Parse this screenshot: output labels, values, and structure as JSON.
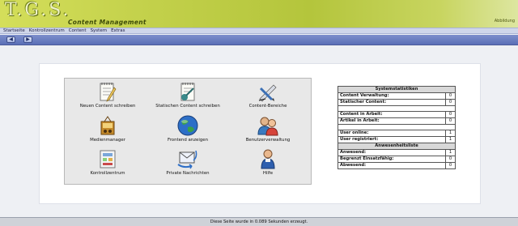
{
  "header": {
    "logo": "T.G.S.",
    "subtitle": "Content Management",
    "corner_text": "Abbildung"
  },
  "menu": [
    "Startseite",
    "Kontrollzentrum",
    "Content",
    "System",
    "Extras"
  ],
  "toolbar": {
    "back_symbol": "◀",
    "forward_symbol": "▶"
  },
  "icons": [
    {
      "label": "Neuen Content schreiben",
      "icon": "notepad-pencil-icon"
    },
    {
      "label": "Statischen Content schreiben",
      "icon": "notepad-tool-icon"
    },
    {
      "label": "Content-Bereiche",
      "icon": "pencil-ruler-icon"
    },
    {
      "label": "Medienmanager",
      "icon": "media-player-icon"
    },
    {
      "label": "Frontend anzeigen",
      "icon": "globe-icon"
    },
    {
      "label": "Benutzerverwaltung",
      "icon": "users-icon"
    },
    {
      "label": "Kontrollzentrum",
      "icon": "control-panel-icon"
    },
    {
      "label": "Private Nachrichten",
      "icon": "messages-icon"
    },
    {
      "label": "Hilfe",
      "icon": "help-icon"
    }
  ],
  "stats": {
    "title": "Systemstatistiken",
    "rows": [
      {
        "label": "Content Verwaltung:",
        "value": "0"
      },
      {
        "label": "Statischer Content:",
        "value": "0"
      },
      {
        "label": "Content in Arbeit:",
        "value": "0"
      },
      {
        "label": "Artikel in Arbeit:",
        "value": "0"
      },
      {
        "label": "User online:",
        "value": "1"
      },
      {
        "label": "User registriert:",
        "value": "1"
      }
    ],
    "section2_title": "Anwesenheitsliste",
    "rows2": [
      {
        "label": "Anwesend:",
        "value": "1"
      },
      {
        "label": "Begrenzt Einsatzfähig:",
        "value": "0"
      },
      {
        "label": "Abwesend:",
        "value": "0"
      }
    ]
  },
  "footer": "Diese Seite wurde in 0.089 Sekunden erzeugt."
}
